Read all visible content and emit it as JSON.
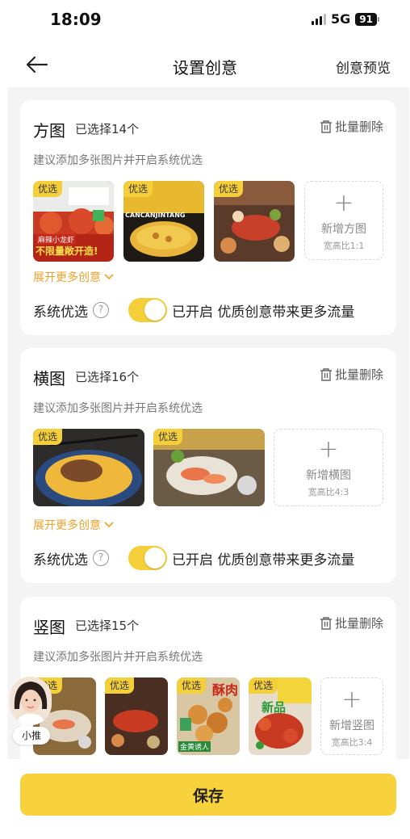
{
  "status_bar": {
    "time": "18:09",
    "network": "5G",
    "battery": "91"
  },
  "nav": {
    "title": "设置创意",
    "preview": "创意预览"
  },
  "sections": [
    {
      "title": "方图",
      "count": "已选择14个",
      "delete_label": "批量删除",
      "hint": "建议添加多张图片并开启系统优选",
      "thumbs": [
        {
          "tag": "优选",
          "overlay_line1": "麻辣小龙虾",
          "overlay_line2": "不限量敞开造!"
        },
        {
          "tag": "优选",
          "overlay_text": "CANCANJINTANG"
        },
        {
          "tag": "优选"
        }
      ],
      "add_label": "新增方图",
      "add_ratio": "宽高比1:1",
      "expand_label": "展开更多创意",
      "optimize_label": "系统优选",
      "optimize_status": "已开启 优质创意带来更多流量"
    },
    {
      "title": "横图",
      "count": "已选择16个",
      "delete_label": "批量删除",
      "hint": "建议添加多张图片并开启系统优选",
      "thumbs": [
        {
          "tag": "优选"
        },
        {
          "tag": "优选"
        }
      ],
      "add_label": "新增横图",
      "add_ratio": "宽高比4:3",
      "expand_label": "展开更多创意",
      "optimize_label": "系统优选",
      "optimize_status": "已开启 优质创意带来更多流量"
    },
    {
      "title": "竖图",
      "count": "已选择15个",
      "delete_label": "批量删除",
      "hint": "建议添加多张图片并开启系统优选",
      "thumbs": [
        {
          "tag": "优选"
        },
        {
          "tag": "优选"
        },
        {
          "tag": "优选",
          "overlay_text": "酥肉",
          "overlay_sub": "金黄诱人"
        },
        {
          "tag": "优选",
          "overlay_text": "新品"
        }
      ],
      "add_label": "新增竖图",
      "add_ratio": "宽高比3:4"
    }
  ],
  "assistant": {
    "label": "小推"
  },
  "footer": {
    "save_label": "保存"
  },
  "colors": {
    "accent": "#f8d23c",
    "tag": "#f5cf3a",
    "expand": "#f0a12a"
  }
}
